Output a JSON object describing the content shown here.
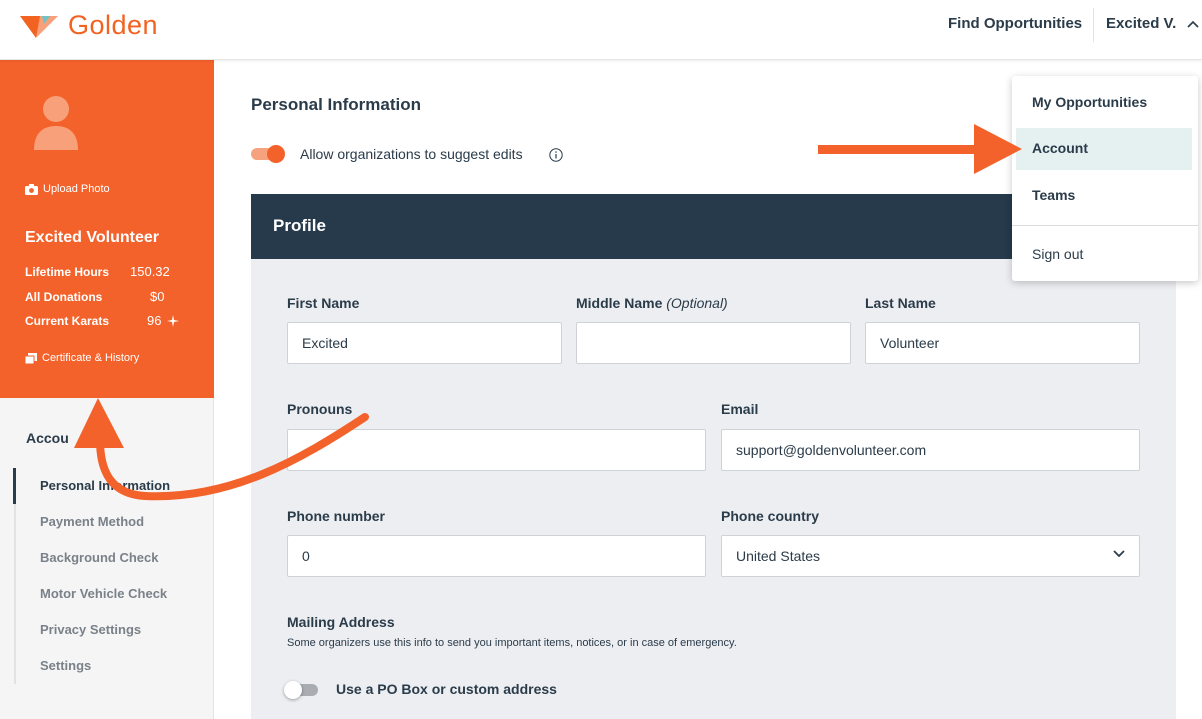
{
  "header": {
    "logo_text": "Golden",
    "find_opportunities": "Find Opportunities",
    "user_name": "Excited V."
  },
  "profile": {
    "upload_photo": "Upload Photo",
    "name": "Excited Volunteer",
    "stats": [
      {
        "label": "Lifetime Hours",
        "value": "150.32"
      },
      {
        "label": "All Donations",
        "value": "$0"
      },
      {
        "label": "Current Karats",
        "value": "96"
      }
    ],
    "certificate": "Certificate & History"
  },
  "sidebar": {
    "title": "Accou",
    "items": [
      {
        "label": "Personal Information"
      },
      {
        "label": "Payment Method"
      },
      {
        "label": "Background Check"
      },
      {
        "label": "Motor Vehicle Check"
      },
      {
        "label": "Privacy Settings"
      },
      {
        "label": "Settings"
      }
    ]
  },
  "main": {
    "title": "Personal Information",
    "allow_edits_label": "Allow organizations to suggest edits",
    "allow_edits_on": true
  },
  "profile_panel": {
    "title": "Profile",
    "first_name": {
      "label": "First Name",
      "value": "Excited"
    },
    "middle_name": {
      "label": "Middle Name",
      "optional": "(Optional)",
      "value": ""
    },
    "last_name": {
      "label": "Last Name",
      "value": "Volunteer"
    },
    "pronouns": {
      "label": "Pronouns",
      "value": ""
    },
    "email": {
      "label": "Email",
      "value": "support@goldenvolunteer.com"
    },
    "phone_number": {
      "label": "Phone number",
      "value": "0"
    },
    "phone_country": {
      "label": "Phone country",
      "value": "United States"
    },
    "mailing_address": {
      "title": "Mailing Address",
      "subtitle": "Some organizers use this info to send you important items, notices, or in case of emergency."
    },
    "po_box": {
      "label": "Use a PO Box or custom address",
      "on": false
    }
  },
  "dropdown": {
    "items": [
      {
        "label": "My Opportunities"
      },
      {
        "label": "Account"
      },
      {
        "label": "Teams"
      }
    ],
    "active_index": 1,
    "sign_out": "Sign out"
  },
  "colors": {
    "brand_orange": "#f4622b",
    "navy": "#263a4b",
    "active_highlight": "#e5f1f1"
  }
}
